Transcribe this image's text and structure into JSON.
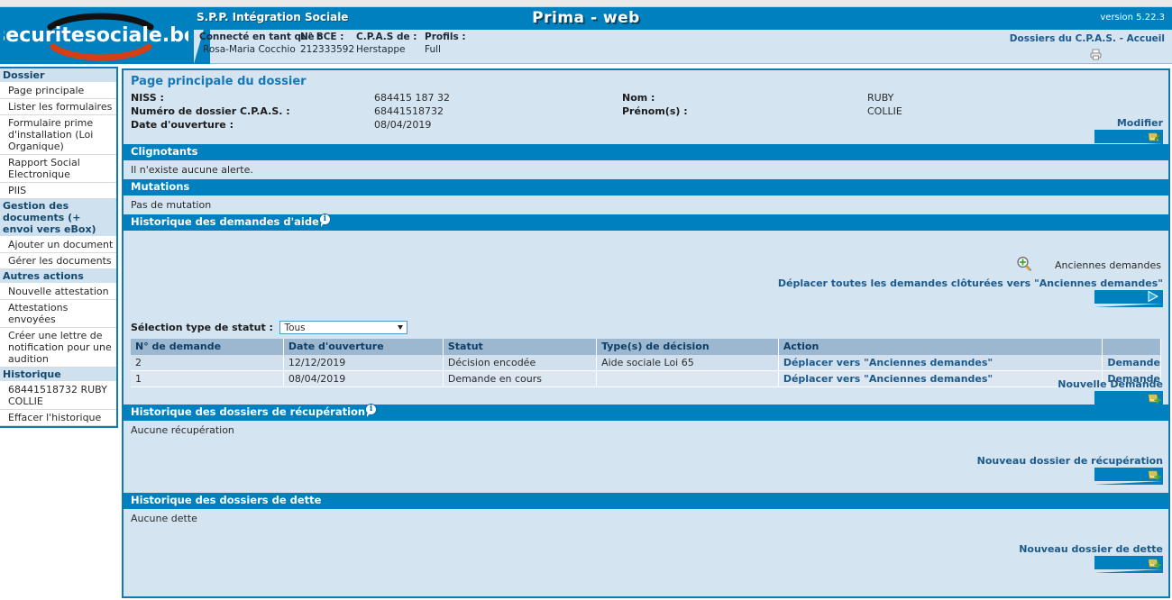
{
  "header": {
    "app_title": "S.P.P. Intégration Sociale",
    "product_title": "Prima - web",
    "version": "version 5.22.3",
    "logo_text": "securitesociale.be",
    "connected_label": "Connecté en tant que :",
    "bce_label": "N° BCE :",
    "cpas_label": "C.P.A.S de :",
    "profils_label": "Profils :",
    "connected_value": "Rosa-Maria Cocchio",
    "bce_value": "212333592",
    "cpas_value": "Herstappe",
    "profils_value": "Full",
    "home_link": "Dossiers du C.P.A.S. - Accueil",
    "printer_icon": "printer-icon"
  },
  "sidebar": {
    "groups": [
      {
        "label": "Dossier",
        "items": [
          "Page principale",
          "Lister les formulaires",
          "Formulaire prime d'installation (Loi Organique)",
          "Rapport Social Electronique",
          "PIIS"
        ]
      },
      {
        "label": "Gestion des documents (+ envoi vers eBox)",
        "items": [
          "Ajouter un document",
          "Gérer les documents"
        ]
      },
      {
        "label": "Autres actions",
        "items": [
          "Nouvelle attestation",
          "Attestations envoyées",
          "Créer une lettre de notification pour une audition"
        ]
      },
      {
        "label": "Historique",
        "items": [
          "68441518732 RUBY COLLIE",
          "Effacer l'historique"
        ]
      }
    ]
  },
  "main": {
    "page_title": "Page principale du dossier",
    "fields": {
      "niss_label": "NISS :",
      "niss_value": "684415 187 32",
      "dossier_label": "Numéro de dossier C.P.A.S. :",
      "dossier_value": "68441518732",
      "ouverture_label": "Date d'ouverture :",
      "ouverture_value": "08/04/2019",
      "nom_label": "Nom :",
      "nom_value": "RUBY",
      "prenom_label": "Prénom(s) :",
      "prenom_value": "COLLIE"
    },
    "modifier_button": "Modifier",
    "sections": {
      "clignotants": {
        "title": "Clignotants",
        "body": "Il n'existe aucune alerte."
      },
      "mutations": {
        "title": "Mutations",
        "body": "Pas de mutation"
      },
      "demandes": {
        "title": "Historique des demandes d'aide",
        "info_icon": "info-icon",
        "anciennes_label": "Anciennes demandes",
        "magnifier_icon": "magnifier-add-icon",
        "deplacer_toutes_label": "Déplacer toutes les demandes clôturées vers \"Anciennes demandes\"",
        "select_label": "Sélection type de statut :",
        "select_value": "Tous",
        "columns": [
          "N° de demande",
          "Date d'ouverture",
          "Statut",
          "Type(s) de décision",
          "Action",
          ""
        ],
        "rows": [
          {
            "numero": "2",
            "date": "12/12/2019",
            "statut": "Décision encodée",
            "type_decision": "Aide sociale Loi 65",
            "action": "Déplacer vers \"Anciennes demandes\"",
            "link": "Demande"
          },
          {
            "numero": "1",
            "date": "08/04/2019",
            "statut": "Demande en cours",
            "type_decision": "",
            "action": "Déplacer vers \"Anciennes demandes\"",
            "link": "Demande"
          }
        ],
        "nouvelle_demande_label": "Nouvelle Demande"
      },
      "recuperation": {
        "title": "Historique des dossiers de récupération",
        "info_icon": "info-icon",
        "body": "Aucune récupération",
        "new_button": "Nouveau dossier de récupération"
      },
      "dette": {
        "title": "Historique des dossiers de dette",
        "body": "Aucune dette",
        "new_button": "Nouveau dossier de dette"
      }
    }
  },
  "colors": {
    "brand_blue": "#0080bf",
    "panel_blue": "#d4e4f1",
    "link_blue": "#1c5a8c",
    "border_blue": "#0f7ab5",
    "table_header": "#9cb8d1"
  }
}
